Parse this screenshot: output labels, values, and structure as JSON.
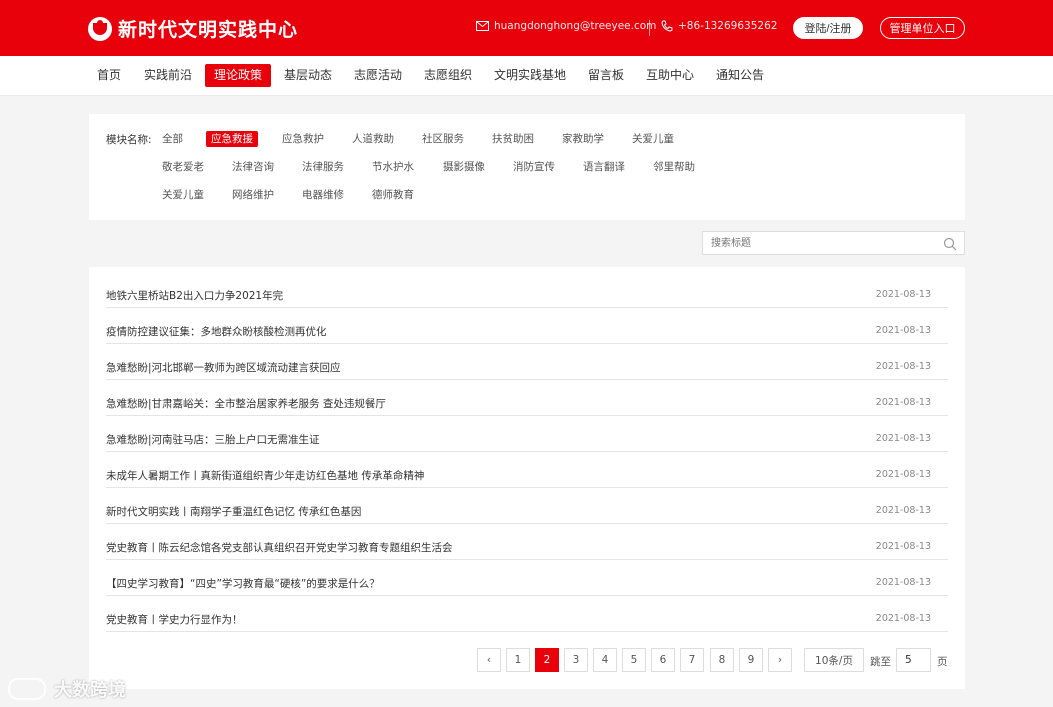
{
  "header": {
    "logo_text": "新时代文明实践中心",
    "email": "huangdonghong@treeyee.com",
    "phone": "+86-13269635262",
    "login_label": "登陆/注册",
    "admin_label": "管理单位入口",
    "bg_color": "#e8000b"
  },
  "nav": {
    "items": [
      "首页",
      "实践前沿",
      "理论政策",
      "基层动态",
      "志愿活动",
      "志愿组织",
      "文明实践基地",
      "留言板",
      "互助中心",
      "通知公告"
    ],
    "active": "理论政策"
  },
  "filter": {
    "label": "模块名称:",
    "tags": [
      "全部",
      "应急救援",
      "应急救护",
      "人道救助",
      "社区服务",
      "扶贫助困",
      "家教助学",
      "关爱儿童",
      "敬老爱老",
      "法律咨询",
      "法律服务",
      "节水护水",
      "摄影摄像",
      "消防宣传",
      "语言翻译",
      "邻里帮助",
      "关爱儿童",
      "网络维护",
      "电器维修",
      "德师教育"
    ],
    "active": "应急救援"
  },
  "search": {
    "placeholder": "搜索标题",
    "icon": "search-icon"
  },
  "articles": [
    {
      "title": "地铁六里桥站B2出入口力争2021年完",
      "date": "2021-08-13"
    },
    {
      "title": "疫情防控建议征集：多地群众盼核酸检测再优化",
      "date": "2021-08-13"
    },
    {
      "title": "急难愁盼|河北邯郸一教师为跨区域流动建言获回应",
      "date": "2021-08-13"
    },
    {
      "title": "急难愁盼|甘肃嘉峪关：全市整治居家养老服务 查处违规餐厅",
      "date": "2021-08-13"
    },
    {
      "title": "急难愁盼|河南驻马店：三胎上户口无需准生证",
      "date": "2021-08-13"
    },
    {
      "title": "未成年人暑期工作丨真新街道组织青少年走访红色基地 传承革命精神",
      "date": "2021-08-13"
    },
    {
      "title": "新时代文明实践丨南翔学子重温红色记忆 传承红色基因",
      "date": "2021-08-13"
    },
    {
      "title": "党史教育丨陈云纪念馆各党支部认真组织召开党史学习教育专题组织生活会",
      "date": "2021-08-13"
    },
    {
      "title": "【四史学习教育】“四史”学习教育最“硬核”的要求是什么？",
      "date": "2021-08-13"
    },
    {
      "title": "党史教育丨学史力行显作为！",
      "date": "2021-08-13"
    }
  ],
  "pagination": {
    "prev": "‹",
    "next": "›",
    "pages": [
      "1",
      "2",
      "3",
      "4",
      "5",
      "6",
      "7",
      "8",
      "9"
    ],
    "current": "2",
    "page_size": "10条/页",
    "jump_label": "跳至",
    "jump_value": "5",
    "jump_unit": "页"
  },
  "watermark": {
    "text": "大数跨境"
  }
}
